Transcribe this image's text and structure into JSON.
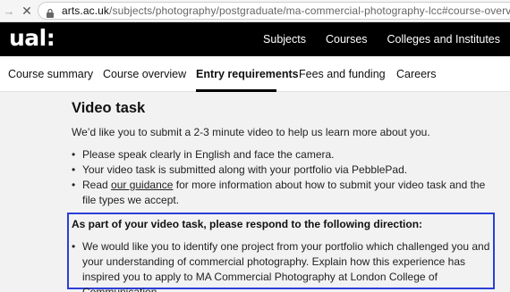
{
  "browser": {
    "url_host": "arts.ac.uk",
    "url_path": "/subjects/photography/postgraduate/ma-commercial-photography-lcc#course-overview"
  },
  "header": {
    "logo": "ual:",
    "nav": [
      "Subjects",
      "Courses",
      "Colleges and Institutes"
    ]
  },
  "tabs": {
    "items": [
      "Course summary",
      "Course overview",
      "Entry requirements",
      "Fees and funding",
      "Careers"
    ],
    "active": "Entry requirements"
  },
  "main": {
    "title": "Video task",
    "intro": "We’d like you to submit a 2-3 minute video to help us learn more about you.",
    "bullet_1": "Please speak clearly in English and face the camera.",
    "bullet_2": "Your video task is submitted along with your portfolio via PebblePad.",
    "bullet_3_prefix": "Read ",
    "bullet_3_link": "our guidance",
    "bullet_3_suffix": " for more information about how to submit your video task and the file types we accept.",
    "direction_heading": "As part of your video task, please respond to the following direction:",
    "direction_item": "We would like you to identify one project from your portfolio which challenged you and your understanding of commercial photography. Explain how this experience has inspired you to apply to MA Commercial Photography at London College of Communication."
  },
  "colors": {
    "highlight_box": "#2b3fd8",
    "header_bg": "#000000",
    "page_bg": "#f2f2f2"
  }
}
